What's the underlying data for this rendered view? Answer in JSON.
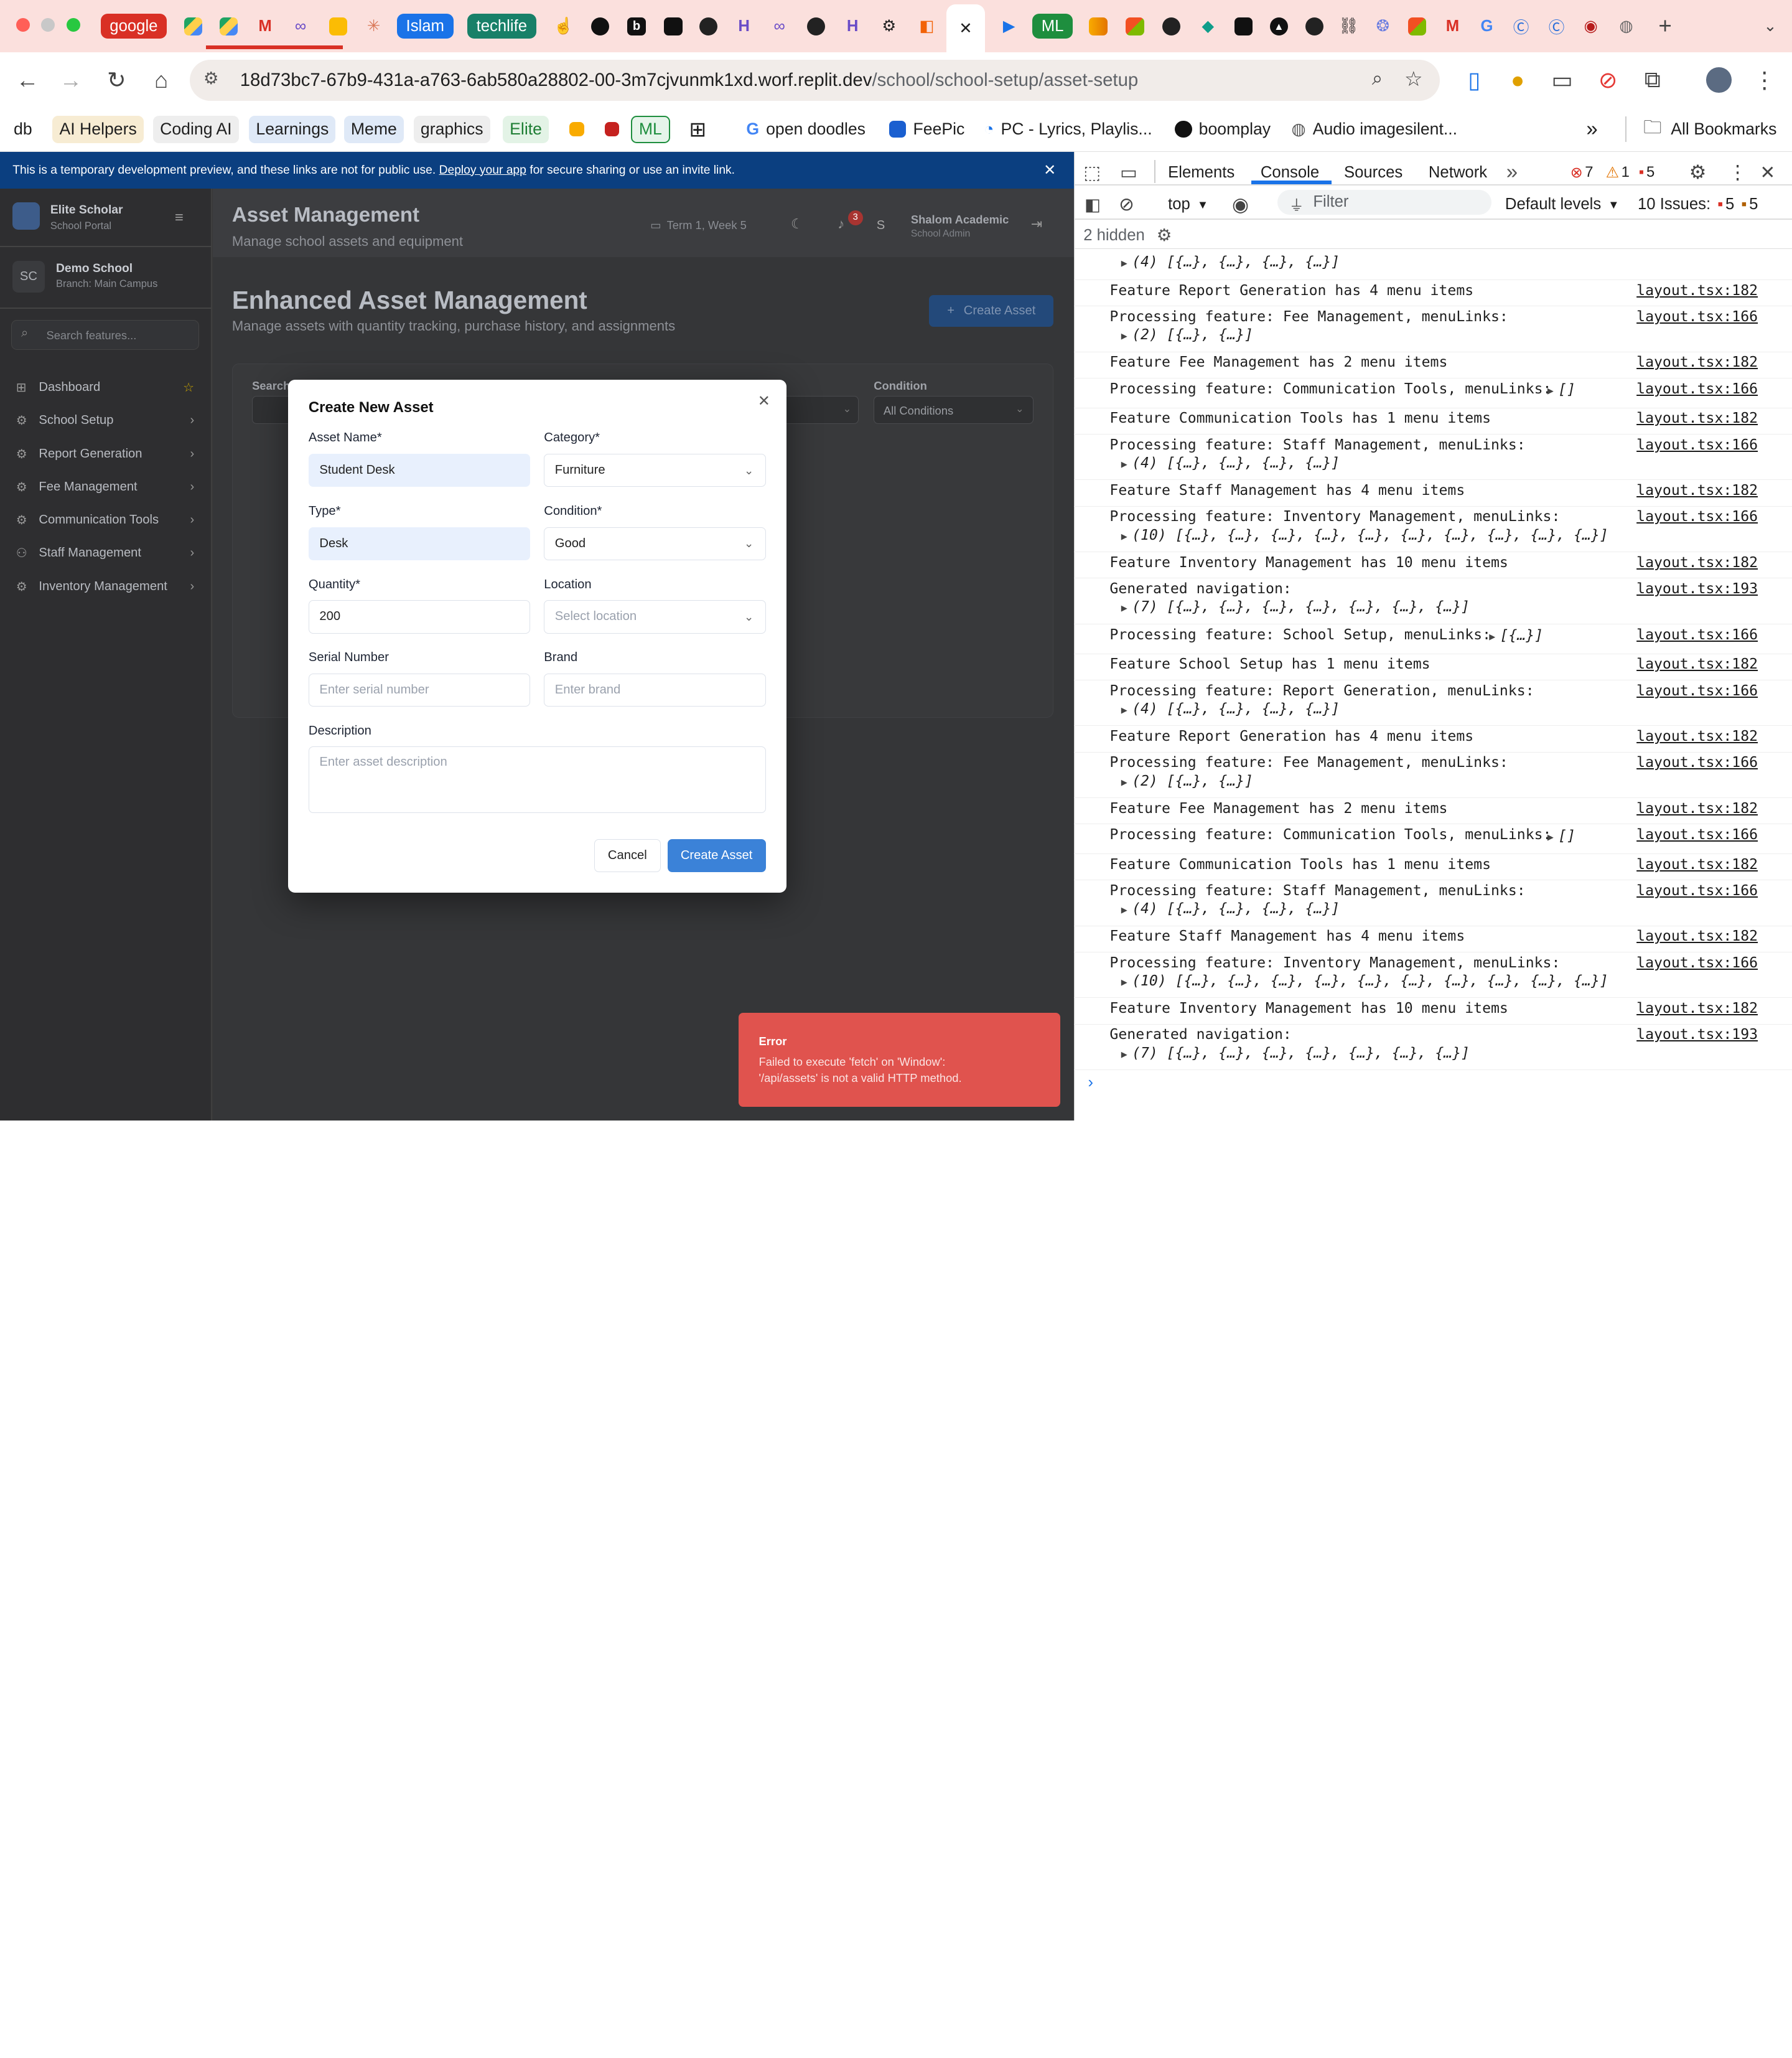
{
  "browser": {
    "tabs": [
      {
        "kind": "pill",
        "label": "google",
        "color": "#d93025"
      },
      {
        "kind": "pill",
        "label": "Islam",
        "color": "#1a73e8"
      },
      {
        "kind": "pill",
        "label": "techlife",
        "color": "#188068"
      },
      {
        "kind": "pill",
        "label": "ML",
        "color": "#1e8e3e"
      }
    ],
    "url_host": "18d73bc7-67b9-431a-a763-6ab580a28802-00-3m7cjvunmk1xd.worf.replit.dev",
    "url_path": "/school/school-setup/asset-setup",
    "bookmarks": [
      "db",
      "AI Helpers",
      "Coding AI",
      "Learnings",
      "Meme",
      "graphics",
      "Elite",
      "ML",
      "open doodles",
      "FeePic",
      "PC - Lyrics, Playlis...",
      "boomplay",
      "Audio imagesilent...",
      "All Bookmarks"
    ],
    "overflow_label": "»"
  },
  "banner": {
    "text_before": "This is a temporary development preview, and these links are not for public use. ",
    "link": "Deploy your app",
    "text_after": " for secure sharing or use an invite link."
  },
  "sidebar": {
    "brand": "Elite Scholar",
    "brand_sub": "School Portal",
    "school_initials": "SC",
    "school": "Demo School",
    "school_branch": "Branch: Main Campus",
    "search_placeholder": "Search features...",
    "items": [
      {
        "label": "Dashboard",
        "icon": "grid-icon"
      },
      {
        "label": "School Setup",
        "icon": "gear-icon"
      },
      {
        "label": "Report Generation",
        "icon": "gear-icon"
      },
      {
        "label": "Fee Management",
        "icon": "gear-icon"
      },
      {
        "label": "Communication Tools",
        "icon": "gear-icon"
      },
      {
        "label": "Staff Management",
        "icon": "users-icon"
      },
      {
        "label": "Inventory Management",
        "icon": "gear-icon"
      }
    ]
  },
  "header": {
    "title": "Asset Management",
    "subtitle": "Manage school assets and equipment",
    "term": "Term 1, Week 5",
    "notif_count": "3",
    "user_initial": "S",
    "user_name": "Shalom Academic",
    "user_role": "School Admin"
  },
  "page": {
    "title": "Enhanced Asset Management",
    "subtitle": "Manage assets with quantity tracking, purchase history, and assignments",
    "create_button": "Create Asset",
    "search_label": "Search",
    "condition_label": "Condition",
    "condition_value": "All Conditions"
  },
  "modal": {
    "title": "Create New Asset",
    "asset_name_label": "Asset Name*",
    "asset_name_value": "Student Desk",
    "category_label": "Category*",
    "category_value": "Furniture",
    "type_label": "Type*",
    "type_value": "Desk",
    "condition_label": "Condition*",
    "condition_value": "Good",
    "quantity_label": "Quantity*",
    "quantity_value": "200",
    "location_label": "Location",
    "location_placeholder": "Select location",
    "serial_label": "Serial Number",
    "serial_placeholder": "Enter serial number",
    "brand_label": "Brand",
    "brand_placeholder": "Enter brand",
    "description_label": "Description",
    "description_placeholder": "Enter asset description",
    "cancel": "Cancel",
    "submit": "Create Asset"
  },
  "toast": {
    "title": "Error",
    "message_line1": "Failed to execute 'fetch' on 'Window':",
    "message_line2": "'/api/assets' is not a valid HTTP method."
  },
  "devtools": {
    "tabs": [
      "Elements",
      "Console",
      "Sources",
      "Network"
    ],
    "active_tab": "Console",
    "errors": "7",
    "warnings": "1",
    "messages": "5",
    "context": "top",
    "filter_placeholder": "Filter",
    "levels": "Default levels",
    "issues_label": "10 Issues:",
    "issues_errors": "5",
    "issues_messages": "5",
    "hidden": "2 hidden",
    "log": [
      {
        "sub": "(4) [{…}, {…}, {…}, {…}]"
      },
      {
        "msg": "Feature Report Generation has 4 menu items",
        "src": "layout.tsx:182"
      },
      {
        "msg": "Processing feature: Fee Management, menuLinks:",
        "src": "layout.tsx:166",
        "sub": "(2) [{…}, {…}]"
      },
      {
        "msg": "Feature Fee Management has 2 menu items",
        "src": "layout.tsx:182"
      },
      {
        "msg": "Processing feature: Communication Tools, menuLinks:",
        "inline": "[]",
        "src": "layout.tsx:166"
      },
      {
        "msg": "Feature Communication Tools has 1 menu items",
        "src": "layout.tsx:182"
      },
      {
        "msg": "Processing feature: Staff Management, menuLinks:",
        "src": "layout.tsx:166",
        "sub": "(4) [{…}, {…}, {…}, {…}]"
      },
      {
        "msg": "Feature Staff Management has 4 menu items",
        "src": "layout.tsx:182"
      },
      {
        "msg": "Processing feature: Inventory Management, menuLinks:",
        "src": "layout.tsx:166",
        "sub": "(10) [{…}, {…}, {…}, {…}, {…}, {…}, {…}, {…}, {…}, {…}]"
      },
      {
        "msg": "Feature Inventory Management has 10 menu items",
        "src": "layout.tsx:182"
      },
      {
        "msg": "Generated navigation:",
        "src": "layout.tsx:193",
        "sub": "(7) [{…}, {…}, {…}, {…}, {…}, {…}, {…}]"
      },
      {
        "msg": "Processing feature: School Setup, menuLinks:",
        "inline": "[{…}]",
        "src": "layout.tsx:166"
      },
      {
        "msg": "Feature School Setup has 1 menu items",
        "src": "layout.tsx:182"
      },
      {
        "msg": "Processing feature: Report Generation, menuLinks:",
        "src": "layout.tsx:166",
        "sub": "(4) [{…}, {…}, {…}, {…}]"
      },
      {
        "msg": "Feature Report Generation has 4 menu items",
        "src": "layout.tsx:182"
      },
      {
        "msg": "Processing feature: Fee Management, menuLinks:",
        "src": "layout.tsx:166",
        "sub": "(2) [{…}, {…}]"
      },
      {
        "msg": "Feature Fee Management has 2 menu items",
        "src": "layout.tsx:182"
      },
      {
        "msg": "Processing feature: Communication Tools, menuLinks:",
        "inline": "[]",
        "src": "layout.tsx:166"
      },
      {
        "msg": "Feature Communication Tools has 1 menu items",
        "src": "layout.tsx:182"
      },
      {
        "msg": "Processing feature: Staff Management, menuLinks:",
        "src": "layout.tsx:166",
        "sub": "(4) [{…}, {…}, {…}, {…}]"
      },
      {
        "msg": "Feature Staff Management has 4 menu items",
        "src": "layout.tsx:182"
      },
      {
        "msg": "Processing feature: Inventory Management, menuLinks:",
        "src": "layout.tsx:166",
        "sub": "(10) [{…}, {…}, {…}, {…}, {…}, {…}, {…}, {…}, {…}, {…}]"
      },
      {
        "msg": "Feature Inventory Management has 10 menu items",
        "src": "layout.tsx:182"
      },
      {
        "msg": "Generated navigation:",
        "src": "layout.tsx:193",
        "sub": "(7) [{…}, {…}, {…}, {…}, {…}, {…}, {…}]"
      }
    ]
  }
}
